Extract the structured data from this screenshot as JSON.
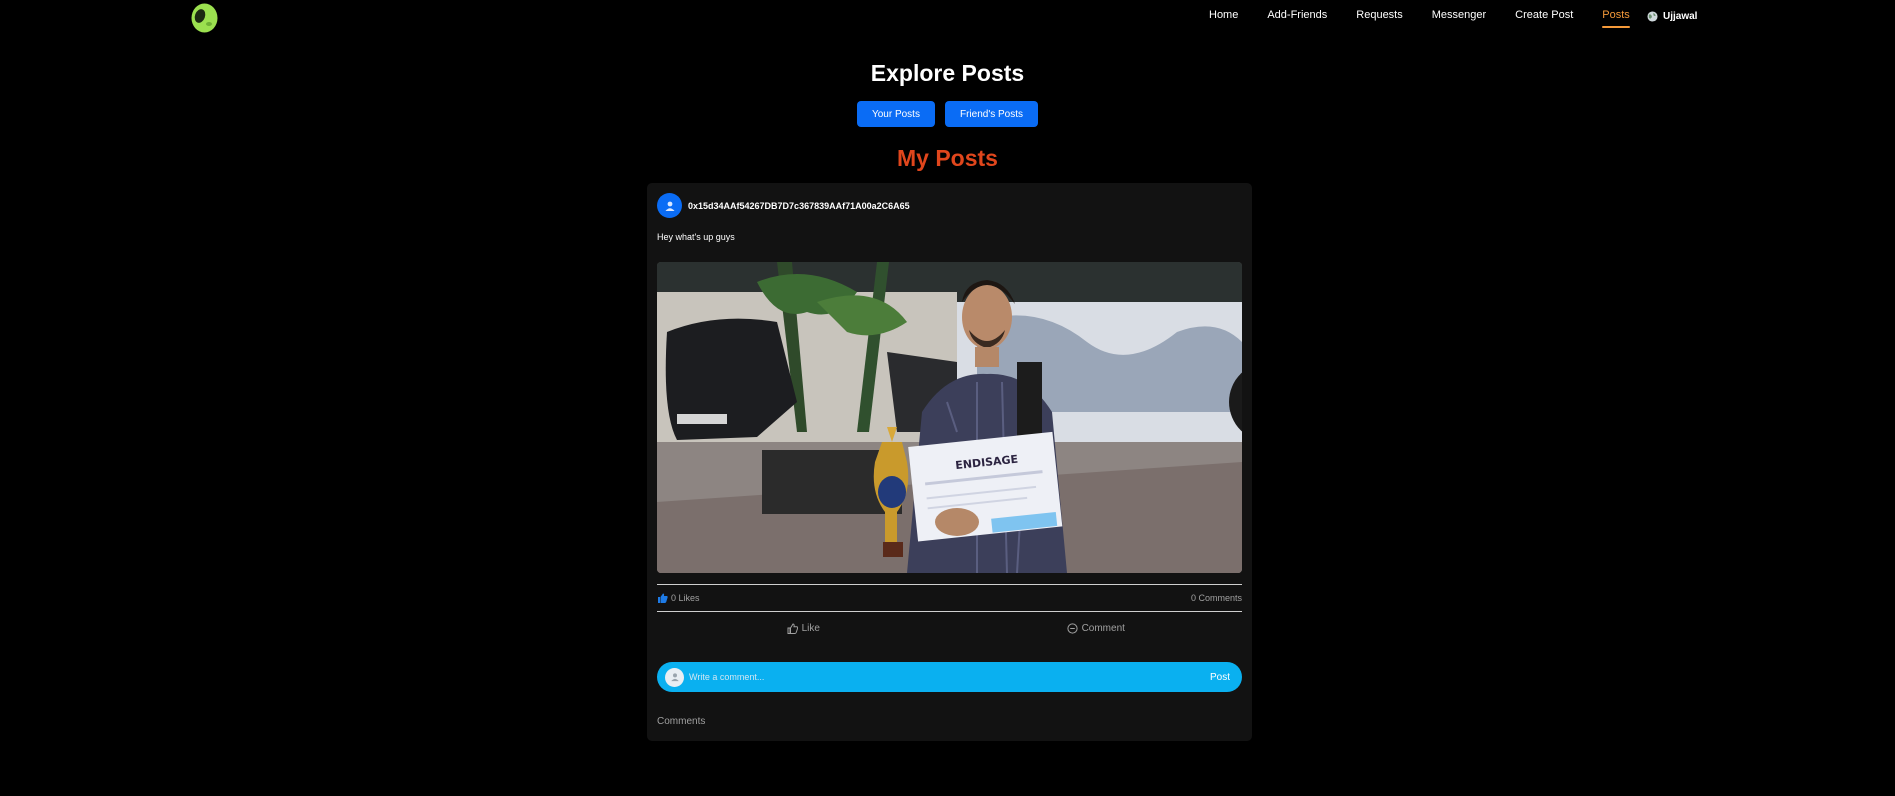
{
  "nav": {
    "logo_icon": "alien-head-logo",
    "links": [
      "Home",
      "Add-Friends",
      "Requests",
      "Messenger",
      "Create Post",
      "Posts"
    ],
    "active": "Posts",
    "user": "Ujjawal",
    "user_icon": "globe-icon"
  },
  "page": {
    "title": "Explore Posts",
    "tabs": [
      "Your Posts",
      "Friend's Posts"
    ],
    "section_title": "My Posts"
  },
  "post": {
    "author": "0x15d34AAf54267DB7D7c367839AAf71A00a2C6A65",
    "text": "Hey what's up guys",
    "image_icon": "post-photo",
    "likes": "0 Likes",
    "comments_count": "0 Comments",
    "like_label": "Like",
    "comment_label": "Comment",
    "comment_placeholder": "Write a comment...",
    "post_button": "Post",
    "comments_heading": "Comments"
  },
  "colors": {
    "background": "#000000",
    "card": "#121212",
    "accent_blue": "#0a6cf5",
    "comment_bar": "#0ab0f0",
    "active_nav": "#f59a3a",
    "section_title": "#e0461c"
  }
}
